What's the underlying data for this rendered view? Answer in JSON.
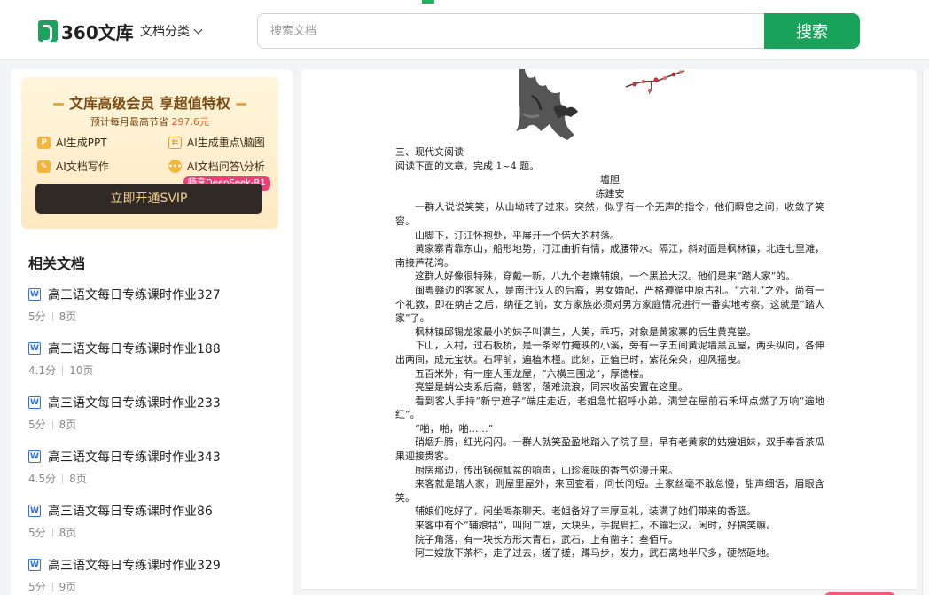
{
  "header": {
    "logo_text": "360文库",
    "category_label": "文档分类",
    "search_placeholder": "搜索文档",
    "search_button": "搜索"
  },
  "vip": {
    "title": "文库高级会员 享超值特权",
    "sub_prefix": "预计每月最高节省",
    "sub_amount": "297.6元",
    "features": [
      "AI生成PPT",
      "AI生成重点\\脑图",
      "AI文档写作",
      "AI文档问答\\分析"
    ],
    "badge": "畅享DeepSeek-R1",
    "cta": "立即开通SVIP"
  },
  "related": {
    "title": "相关文档",
    "items": [
      {
        "name": "高三语文每日专练课时作业327",
        "score": "5分",
        "pages": "8页"
      },
      {
        "name": "高三语文每日专练课时作业188",
        "score": "4.1分",
        "pages": "10页"
      },
      {
        "name": "高三语文每日专练课时作业233",
        "score": "5分",
        "pages": "8页"
      },
      {
        "name": "高三语文每日专练课时作业343",
        "score": "4.5分",
        "pages": "8页"
      },
      {
        "name": "高三语文每日专练课时作业86",
        "score": "5分",
        "pages": "8页"
      },
      {
        "name": "高三语文每日专练课时作业329",
        "score": "5分",
        "pages": "9页"
      }
    ]
  },
  "document": {
    "lines": [
      {
        "t": "三、现代文阅读",
        "s": "plain"
      },
      {
        "t": "阅读下面的文章，完成 1~4 题。",
        "s": "plain"
      },
      {
        "t": "墟胆",
        "s": "center"
      },
      {
        "t": "练建安",
        "s": "center"
      },
      {
        "t": "一群人说说笑笑，从山坳转了过来。突然，似乎有一个无声的指令，他们瞬息之间，收敛了笑容。",
        "s": "indent"
      },
      {
        "t": "山脚下，汀江怀抱处，平展开一个偌大的村落。",
        "s": "indent"
      },
      {
        "t": "黄家寨背靠东山，船形地势，汀江曲折有情，成腰带水。隔江，斜对面是枫林镇，北连七里滩，南接芦花湾。",
        "s": "indent"
      },
      {
        "t": "这群人好像很特殊，穿戴一新，八九个老嫩辅娘，一个黑脸大汉。他们是来“踏人家”的。",
        "s": "indent"
      },
      {
        "t": "闽粤赣边的客家人，是南迁汉人的后裔，男女婚配，严格遵循中原古礼。“六礼”之外，尚有一个礼数，即在纳吉之后，纳征之前，女方家族必须对男方家庭情况进行一番实地考察。这就是“踏人家”了。",
        "s": "indent"
      },
      {
        "t": "枫林镇邱锡龙家最小的妹子叫满兰，人美，乖巧，对象是黄家寨的后生黄亮堂。",
        "s": "indent"
      },
      {
        "t": "下山，入村，过石板桥，是一条翠竹掩映的小溪，旁有一字五间黄泥墙黑瓦屋，两头纵向，各伸出两间，成元宝状。石坪前，遍植木槿。此刻，正值已时，紫花朵朵，迎风摇曳。",
        "s": "indent"
      },
      {
        "t": "五百米外，有一座大围龙屋，“六横三围龙”，厚德楼。",
        "s": "indent"
      },
      {
        "t": "亮堂是蛸公支系后裔，赣客，落难流浪，同宗收留安置在这里。",
        "s": "indent"
      },
      {
        "t": "看到客人手持“新宁遮子”端庄走近，老姐急忙招呼小弟。满堂在屋前石禾坪点燃了万响“遍地红”。",
        "s": "indent"
      },
      {
        "t": "“啪，啪，啪……”",
        "s": "indent"
      },
      {
        "t": "硝烟升腾，红光闪闪。一群人就笑盈盈地踏入了院子里，早有老黄家的姑嫂姐妹，双手奉香茶瓜果迎接贵客。",
        "s": "indent"
      },
      {
        "t": "厨房那边，传出锅碗瓢盆的响声，山珍海味的香气弥漫开来。",
        "s": "indent"
      },
      {
        "t": "来客就是踏人家，则屋里屋外，来回查看，问长问短。主家丝毫不敢怠慢，甜声细语，眉眼含笑。",
        "s": "indent"
      },
      {
        "t": "辅娘们吃好了，闲坐喝茶聊天。老姐备好了丰厚回礼，装满了她们带来的香篮。",
        "s": "indent"
      },
      {
        "t": "来客中有个“辅娘牯”，叫阿二嫂，大块头，手提肩扛，不输壮汉。闲时，好搞笑嘛。",
        "s": "indent"
      },
      {
        "t": "院子角落，有一块长方形大青石，武石，上有凿字：叁佰斤。",
        "s": "indent"
      },
      {
        "t": "阿二嫂放下茶杯，走了过去，搓了搓，蹲马步，发力，武石离地半尺多，硬然砸地。",
        "s": "indent"
      }
    ]
  }
}
